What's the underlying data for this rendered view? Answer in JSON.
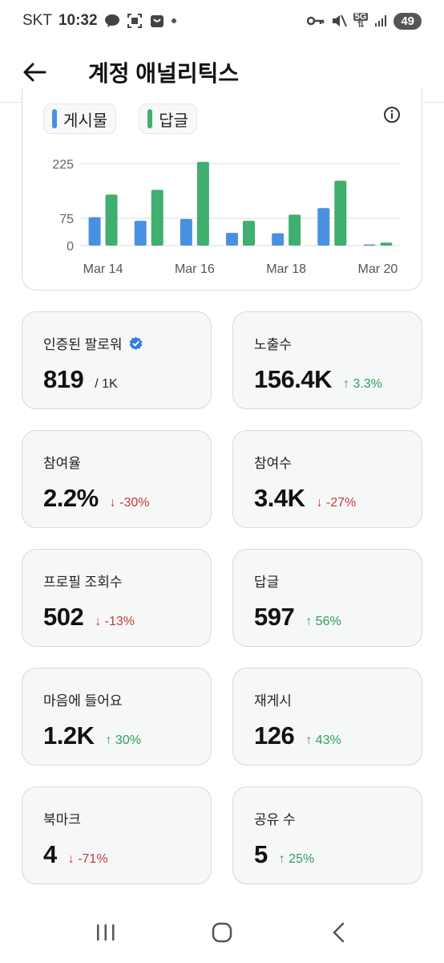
{
  "status_bar": {
    "carrier": "SKT",
    "time": "10:32",
    "network": "5G",
    "battery": "49"
  },
  "header": {
    "title": "계정 애널리틱스"
  },
  "colors": {
    "posts": "#4a90e2",
    "replies": "#3fae6e",
    "up": "#2f9e63",
    "down": "#c73a3a",
    "verified": "#2f7de1"
  },
  "chart_data": {
    "type": "bar",
    "categories": [
      "Mar 14",
      "Mar 15",
      "Mar 16",
      "Mar 17",
      "Mar 18",
      "Mar 19",
      "Mar 20"
    ],
    "x_tick_labels": [
      "Mar 14",
      "Mar 16",
      "Mar 18",
      "Mar 20"
    ],
    "y_ticks": [
      0,
      75,
      225
    ],
    "ylim": [
      0,
      225
    ],
    "series": [
      {
        "name": "게시물",
        "color": "#4a90e2",
        "values": [
          78,
          68,
          73,
          35,
          34,
          103,
          3
        ]
      },
      {
        "name": "답글",
        "color": "#3fae6e",
        "values": [
          140,
          153,
          230,
          68,
          85,
          178,
          8
        ]
      }
    ],
    "legend": [
      "게시물",
      "답글"
    ],
    "grid": true
  },
  "stats": [
    {
      "label": "인증된 팔로워",
      "value": "819",
      "suffix": "/ 1K",
      "change": "",
      "direction": "none",
      "verified": true
    },
    {
      "label": "노출수",
      "value": "156.4K",
      "suffix": "",
      "change": "↑ 3.3%",
      "direction": "up"
    },
    {
      "label": "참여율",
      "value": "2.2%",
      "suffix": "",
      "change": "↓ -30%",
      "direction": "down"
    },
    {
      "label": "참여수",
      "value": "3.4K",
      "suffix": "",
      "change": "↓ -27%",
      "direction": "down"
    },
    {
      "label": "프로필 조회수",
      "value": "502",
      "suffix": "",
      "change": "↓ -13%",
      "direction": "down"
    },
    {
      "label": "답글",
      "value": "597",
      "suffix": "",
      "change": "↑ 56%",
      "direction": "up"
    },
    {
      "label": "마음에 들어요",
      "value": "1.2K",
      "suffix": "",
      "change": "↑ 30%",
      "direction": "up"
    },
    {
      "label": "재게시",
      "value": "126",
      "suffix": "",
      "change": "↑ 43%",
      "direction": "up"
    },
    {
      "label": "북마크",
      "value": "4",
      "suffix": "",
      "change": "↓ -71%",
      "direction": "down"
    },
    {
      "label": "공유 수",
      "value": "5",
      "suffix": "",
      "change": "↑ 25%",
      "direction": "up"
    }
  ]
}
